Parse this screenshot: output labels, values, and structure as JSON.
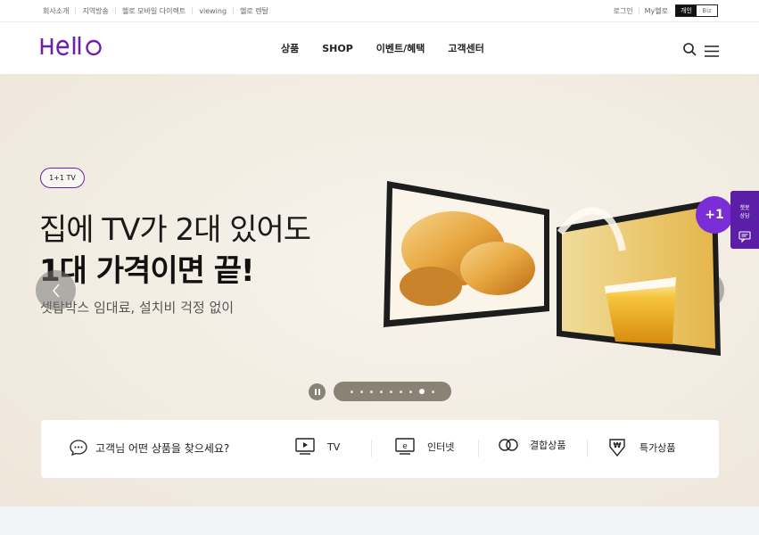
{
  "util": {
    "left": [
      "회사소개",
      "지역방송",
      "헬로 모바일 다이렉트",
      "viewing",
      "헬로 렌탈"
    ],
    "right": [
      "로그인",
      "My헬로"
    ],
    "segment": {
      "personal": "개인",
      "biz": "Biz"
    }
  },
  "header": {
    "logo": "HeIIO",
    "nav": [
      "상품",
      "SHOP",
      "이벤트/혜택",
      "고객센터"
    ],
    "icons": [
      "search-icon",
      "menu-icon"
    ]
  },
  "hero": {
    "badge": "1+1 TV",
    "line1": "집에 TV가 2대 있어도",
    "line2": "1대 가격이면 끝!",
    "sub": "셋탑박스 임대료, 설치비 걱정 없이",
    "plus_badge": "+1",
    "slide_count": 9,
    "active_slide": 8
  },
  "side_chat": {
    "label_line1": "챗봇",
    "label_line2": "상담"
  },
  "finder": {
    "question": "고객님 어떤 상품을 찾으세요?",
    "categories": [
      {
        "label": "TV",
        "icon": "tv-icon"
      },
      {
        "label": "인터넷",
        "icon": "internet-icon"
      },
      {
        "label": "결합상품",
        "icon": "bundle-icon"
      },
      {
        "label": "특가상품",
        "icon": "special-price-icon"
      }
    ]
  },
  "colors": {
    "brand": "#6b21a8",
    "chat": "#5b1ea6",
    "pager": "#8b8276"
  }
}
